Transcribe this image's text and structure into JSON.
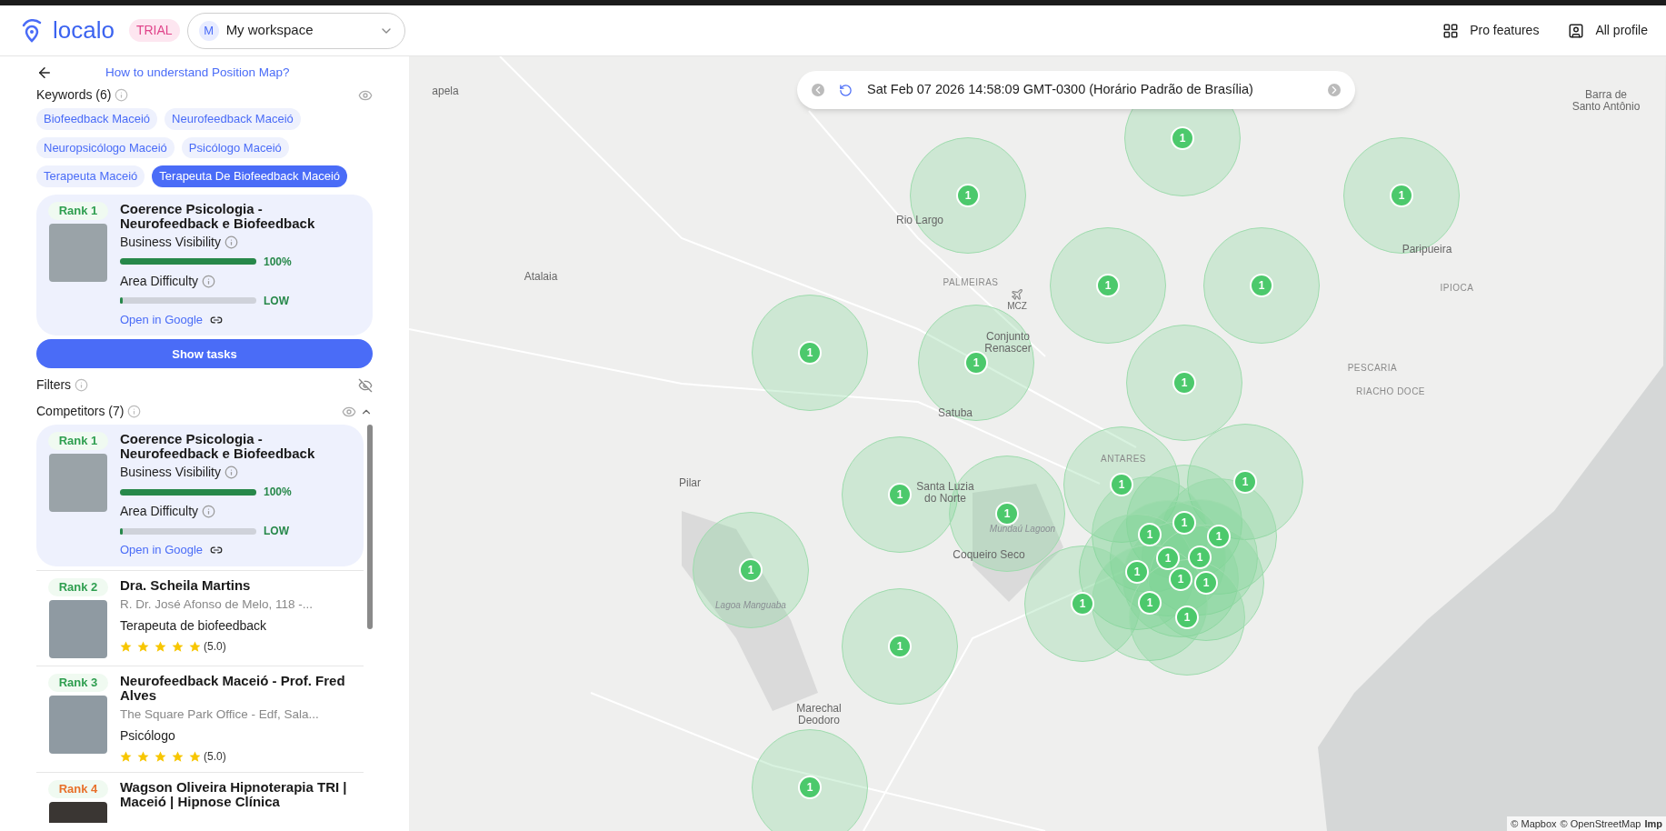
{
  "header": {
    "logo": "localo",
    "plan_badge": "TRIAL",
    "workspace": {
      "avatar": "M",
      "value": "My workspace"
    },
    "actions": [
      {
        "kind": "grid",
        "label": "Pro features"
      },
      {
        "kind": "profiles",
        "label": "All profile"
      }
    ]
  },
  "sidebar": {
    "help_link": "How to understand Position Map?",
    "keywords": {
      "title": "Keywords (6)",
      "items": [
        {
          "label": "Biofeedback Maceió",
          "selected": false
        },
        {
          "label": "Neurofeedback Maceió",
          "selected": false
        },
        {
          "label": "Neuropsicólogo Maceió",
          "selected": false
        },
        {
          "label": "Psicólogo Maceió",
          "selected": false
        },
        {
          "label": "Terapeuta Maceió",
          "selected": false
        },
        {
          "label": "Terapeuta De Biofeedback Maceió",
          "selected": true
        }
      ]
    },
    "business": {
      "rank": "Rank 1",
      "color": "#2e9e4f",
      "name": "Coerence Psicologia - Neurofeedback e Biofeedback",
      "visibility_label": "Business Visibility",
      "visibility": {
        "level": 1.0,
        "reading": "100%"
      },
      "difficulty_label": "Area Difficulty",
      "difficulty": {
        "level": 0.02,
        "reading": "LOW"
      },
      "link": "Open in Google"
    },
    "show_tasks": "Show tasks",
    "filters": {
      "title": "Filters"
    },
    "competitors": {
      "title": "Competitors (7)",
      "items": [
        {
          "kind": "metrics",
          "selected": true,
          "rank": "Rank 1",
          "color": "#2e9e4f",
          "name": "Coerence Psicologia - Neurofeedback e Biofeedback",
          "visibility_label": "Business Visibility",
          "visibility": {
            "level": 1.0,
            "reading": "100%"
          },
          "difficulty_label": "Area Difficulty",
          "difficulty": {
            "level": 0.02,
            "reading": "LOW"
          },
          "link": "Open in Google"
        },
        {
          "kind": "rating",
          "selected": false,
          "rank": "Rank 2",
          "color": "#2e9e4f",
          "name": "Dra. Scheila Martins",
          "address": "R. Dr. José Afonso de Melo, 118 -...",
          "category": "Terapeuta de biofeedback",
          "stars": 5,
          "rating": "(5.0)"
        },
        {
          "kind": "rating",
          "selected": false,
          "rank": "Rank 3",
          "color": "#2e9e4f",
          "name": "Neurofeedback Maceió - Prof. Fred Alves",
          "address": "The Square Park Office - Edf, Sala...",
          "category": "Psicólogo",
          "stars": 5,
          "rating": "(5.0)"
        },
        {
          "kind": "partial",
          "selected": false,
          "rank": "Rank 4",
          "color": "#e8702a",
          "name": "Wagson Oliveira Hipnoterapia TRI | Maceió | Hipnose Clínica"
        }
      ]
    }
  },
  "map": {
    "time": "Sat Feb 07 2026 14:58:09 GMT-0300 (Horário Padrão de Brasília)",
    "places": [
      {
        "kind": "town",
        "name": "apela"
      },
      {
        "kind": "town",
        "name": "Barra de Santo Antônio"
      },
      {
        "kind": "town",
        "name": "Rio Largo"
      },
      {
        "kind": "town",
        "name": "Paripueira"
      },
      {
        "kind": "town",
        "name": "Atalaia"
      },
      {
        "kind": "district",
        "name": "PALMEIRAS"
      },
      {
        "kind": "district",
        "name": "IPIOCA"
      },
      {
        "kind": "airport",
        "name": "MCZ"
      },
      {
        "kind": "town",
        "name": "Conjunto Renascer"
      },
      {
        "kind": "district",
        "name": "PESCARIA"
      },
      {
        "kind": "district",
        "name": "RIACHO DOCE"
      },
      {
        "kind": "town",
        "name": "Satuba"
      },
      {
        "kind": "district",
        "name": "ANTARES"
      },
      {
        "kind": "town",
        "name": "Pilar"
      },
      {
        "kind": "town",
        "name": "Santa Luzia do Norte"
      },
      {
        "kind": "water",
        "name": "Mundaú Lagoon"
      },
      {
        "kind": "town",
        "name": "Coqueiro Seco"
      },
      {
        "kind": "water",
        "name": "Lagoa Manguaba"
      },
      {
        "kind": "town",
        "name": "Marechal Deodoro"
      }
    ],
    "markers": [
      {
        "label": "1"
      },
      {
        "label": "1"
      },
      {
        "label": "1"
      },
      {
        "label": "1"
      },
      {
        "label": "1"
      },
      {
        "label": "1"
      },
      {
        "label": "1"
      },
      {
        "label": "1"
      },
      {
        "label": "1"
      },
      {
        "label": "1"
      },
      {
        "label": "1"
      },
      {
        "label": "1"
      },
      {
        "label": "1"
      },
      {
        "label": "1"
      },
      {
        "label": "1"
      },
      {
        "label": "1"
      },
      {
        "label": "1"
      },
      {
        "label": "1"
      },
      {
        "label": "1"
      },
      {
        "label": "1"
      },
      {
        "label": "1"
      },
      {
        "label": "1"
      },
      {
        "label": "1"
      },
      {
        "label": "1"
      },
      {
        "label": "1"
      },
      {
        "label": "1"
      }
    ],
    "attribution": [
      "© Mapbox",
      "© OpenStreetMap",
      "Imp"
    ]
  }
}
